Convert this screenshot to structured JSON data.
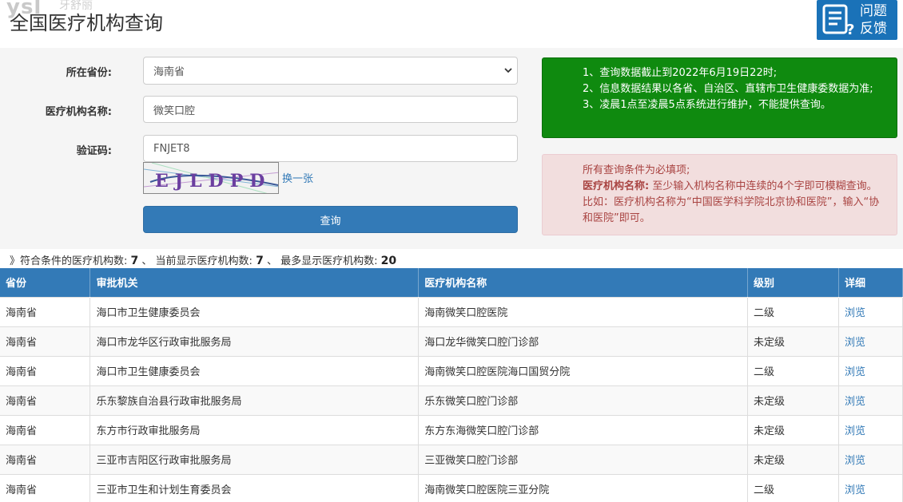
{
  "header": {
    "watermark": "ysl",
    "watermark_sub": "牙舒丽",
    "title": "全国医疗机构查询",
    "feedback_line1": "问题",
    "feedback_line2": "反馈"
  },
  "form": {
    "province_label": "所在省份:",
    "province_value": "海南省",
    "org_name_label": "医疗机构名称:",
    "org_name_value": "微笑口腔",
    "captcha_label": "验证码:",
    "captcha_value": "FNJET8",
    "captcha_image_text": "EJLDPD",
    "refresh_label": "换一张",
    "query_button": "查询"
  },
  "notice_info": {
    "line1": "1、查询数据截止到2022年6月19日22时;",
    "line2": "2、信息数据结果以各省、自治区、直辖市卫生健康委数据为准;",
    "line3": "3、凌晨1点至凌晨5点系统进行维护，不能提供查询。"
  },
  "notice_warning": {
    "line1": "所有查询条件为必填项;",
    "line2_bold": "医疗机构名称:",
    "line2_rest": " 至少输入机构名称中连续的4个字即可模糊查询。比如：医疗机构名称为“中国医学科学院北京协和医院”，输入“协和医院”即可。"
  },
  "summary": {
    "prefix": "》符合条件的医疗机构数:",
    "matched": "7",
    "sep1": "、 当前显示医疗机构数:",
    "shown": "7",
    "sep2": "、 最多显示医疗机构数:",
    "max": "20"
  },
  "table": {
    "headers": [
      "省份",
      "审批机关",
      "医疗机构名称",
      "级别",
      "详细"
    ],
    "rows": [
      [
        "海南省",
        "海口市卫生健康委员会",
        "海南微笑口腔医院",
        "二级",
        "浏览"
      ],
      [
        "海南省",
        "海口市龙华区行政审批服务局",
        "海口龙华微笑口腔门诊部",
        "未定级",
        "浏览"
      ],
      [
        "海南省",
        "海口市卫生健康委员会",
        "海南微笑口腔医院海口国贸分院",
        "二级",
        "浏览"
      ],
      [
        "海南省",
        "乐东黎族自治县行政审批服务局",
        "乐东微笑口腔门诊部",
        "未定级",
        "浏览"
      ],
      [
        "海南省",
        "东方市行政审批服务局",
        "东方东海微笑口腔门诊部",
        "未定级",
        "浏览"
      ],
      [
        "海南省",
        "三亚市吉阳区行政审批服务局",
        "三亚微笑口腔门诊部",
        "未定级",
        "浏览"
      ],
      [
        "海南省",
        "三亚市卫生和计划生育委员会",
        "海南微笑口腔医院三亚分院",
        "二级",
        "浏览"
      ]
    ]
  }
}
